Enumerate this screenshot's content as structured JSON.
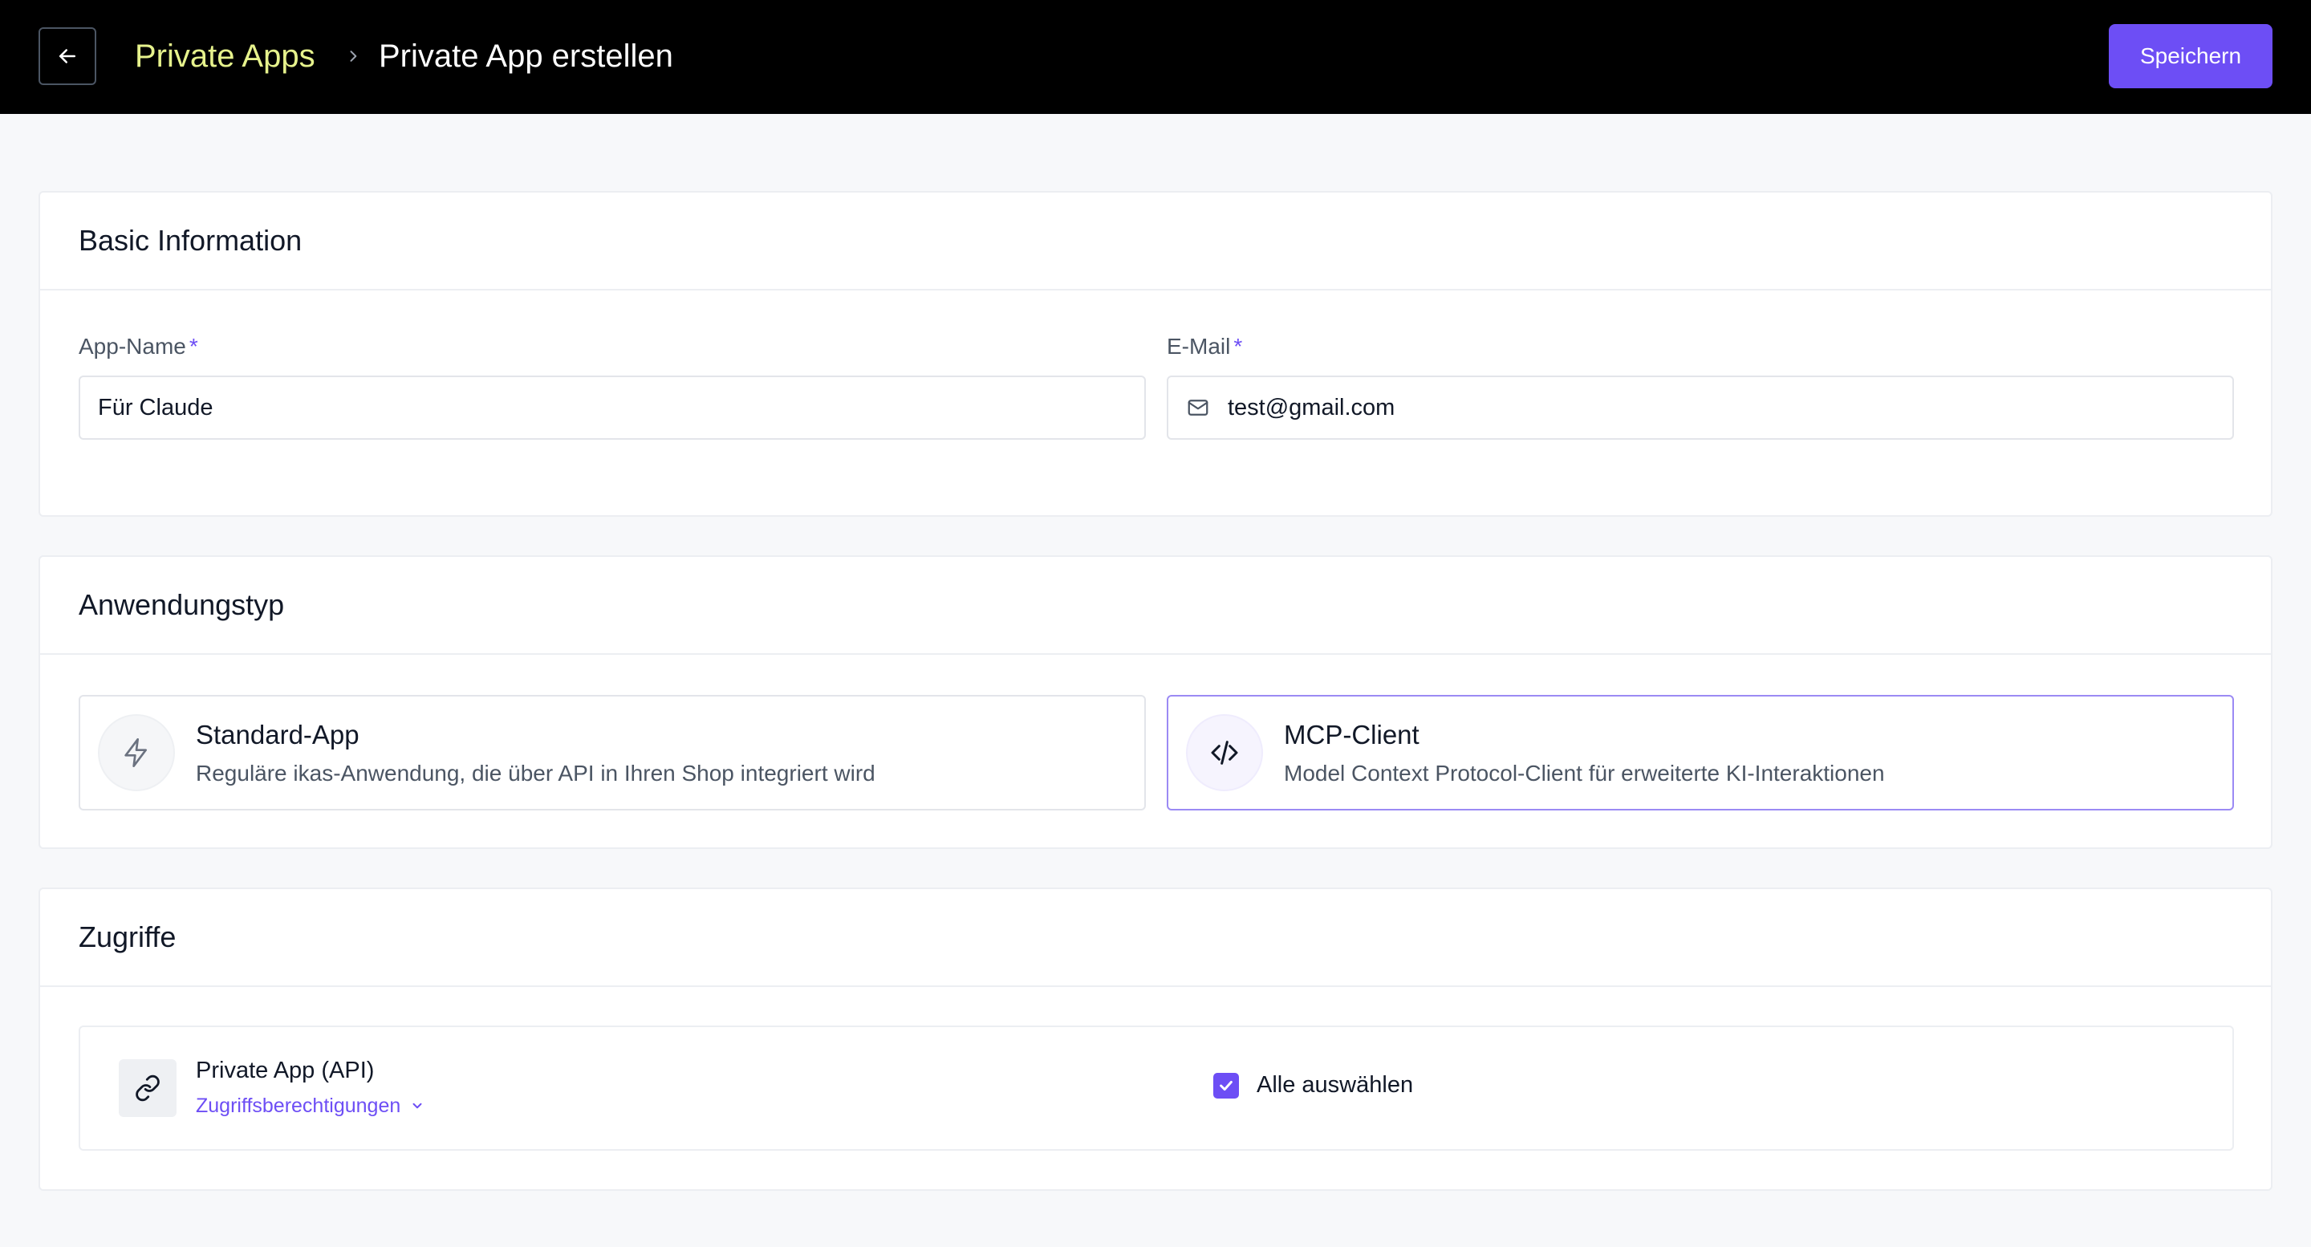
{
  "header": {
    "breadcrumb_parent": "Private Apps",
    "breadcrumb_current": "Private App erstellen",
    "save_label": "Speichern"
  },
  "basic_info": {
    "title": "Basic Information",
    "app_name_label": "App-Name",
    "app_name_value": "Für Claude",
    "email_label": "E-Mail",
    "email_value": "test@gmail.com",
    "required_mark": "*"
  },
  "app_type": {
    "title": "Anwendungstyp",
    "options": [
      {
        "title": "Standard-App",
        "description": "Reguläre ikas-Anwendung, die über API in Ihren Shop integriert wird",
        "icon": "lightning-icon",
        "selected": false
      },
      {
        "title": "MCP-Client",
        "description": "Model Context Protocol-Client für erweiterte KI-Interaktionen",
        "icon": "code-icon",
        "selected": true
      }
    ]
  },
  "access": {
    "title": "Zugriffe",
    "item_title": "Private App (API)",
    "permissions_link": "Zugriffsberechtigungen",
    "select_all_label": "Alle auswählen",
    "select_all_checked": true
  },
  "colors": {
    "accent": "#6d4ef5",
    "breadcrumb_link": "#e6f28c",
    "topbar": "#000000"
  }
}
